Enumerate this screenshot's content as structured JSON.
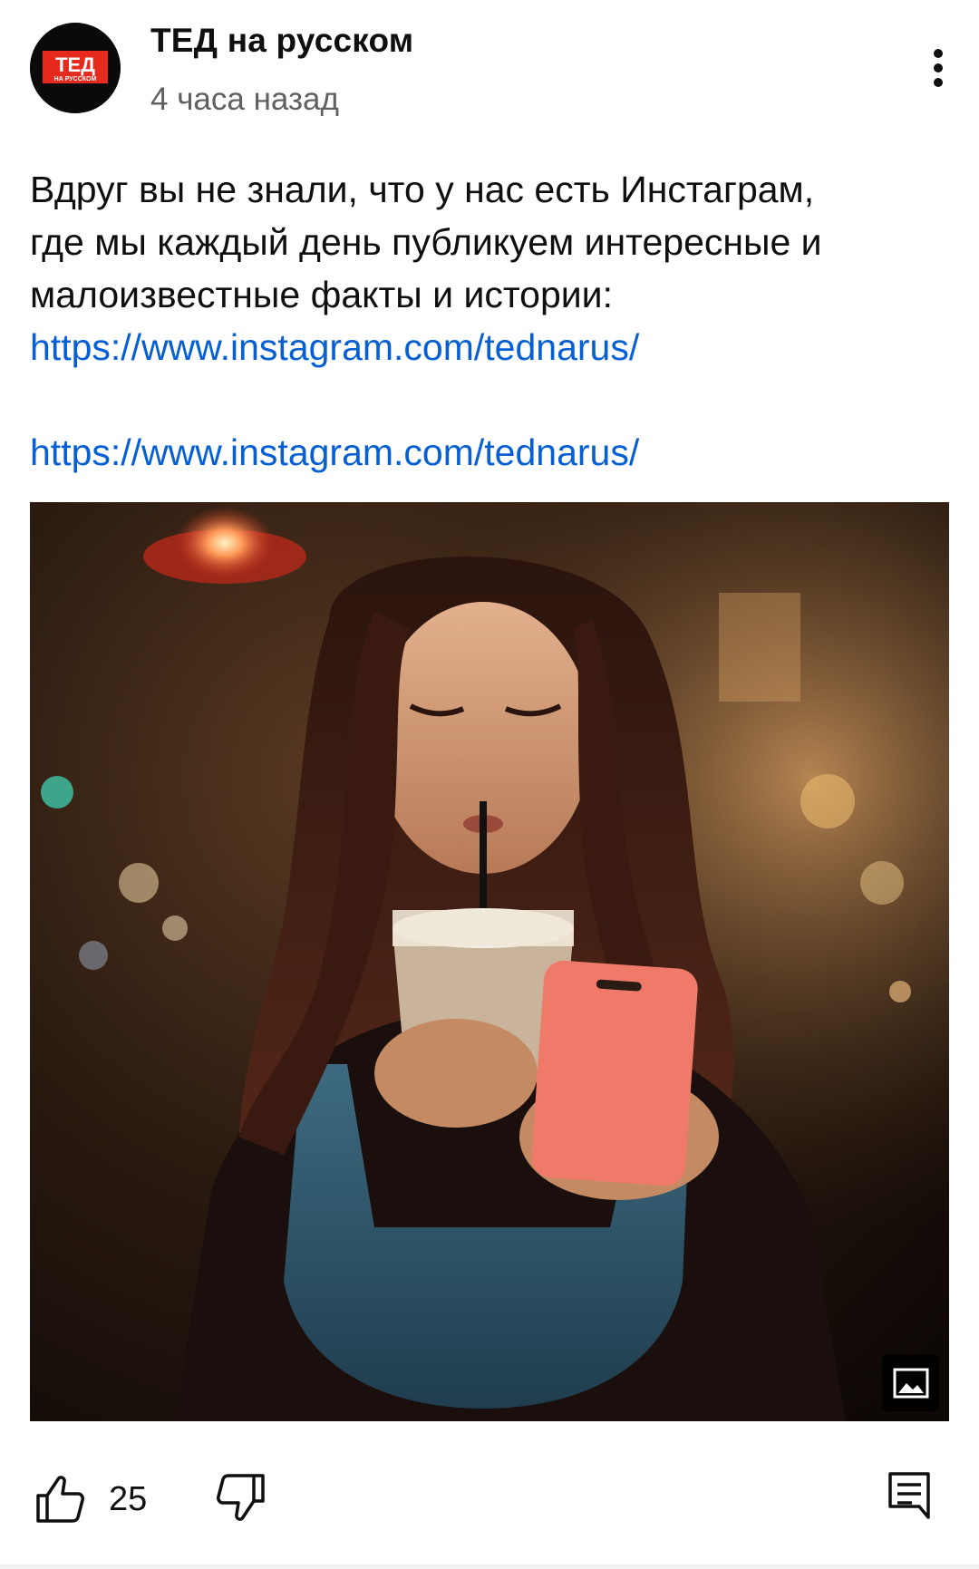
{
  "channel": {
    "name": "ТЕД на русском",
    "time": "4 часа назад",
    "avatar_line1": "ТЕД",
    "avatar_line2": "НА РУССКОМ"
  },
  "post": {
    "text_line1": "Вдруг вы не знали, что у нас есть Инстаграм,",
    "text_line2": "где мы каждый день публикуем интересные и",
    "text_line3": "малоизвестные факты и истории:",
    "link1": "https://www.instagram.com/tednarus/",
    "link2": "https://www.instagram.com/tednarus/"
  },
  "actions": {
    "like_count": "25"
  },
  "icons": {
    "menu": "more-vert-icon",
    "like": "thumb-up-icon",
    "dislike": "thumb-down-icon",
    "comment": "comment-icon",
    "image_badge": "image-icon"
  },
  "colors": {
    "link": "#065fd4",
    "secondary_text": "#606060",
    "ted_red": "#e62b1e"
  }
}
